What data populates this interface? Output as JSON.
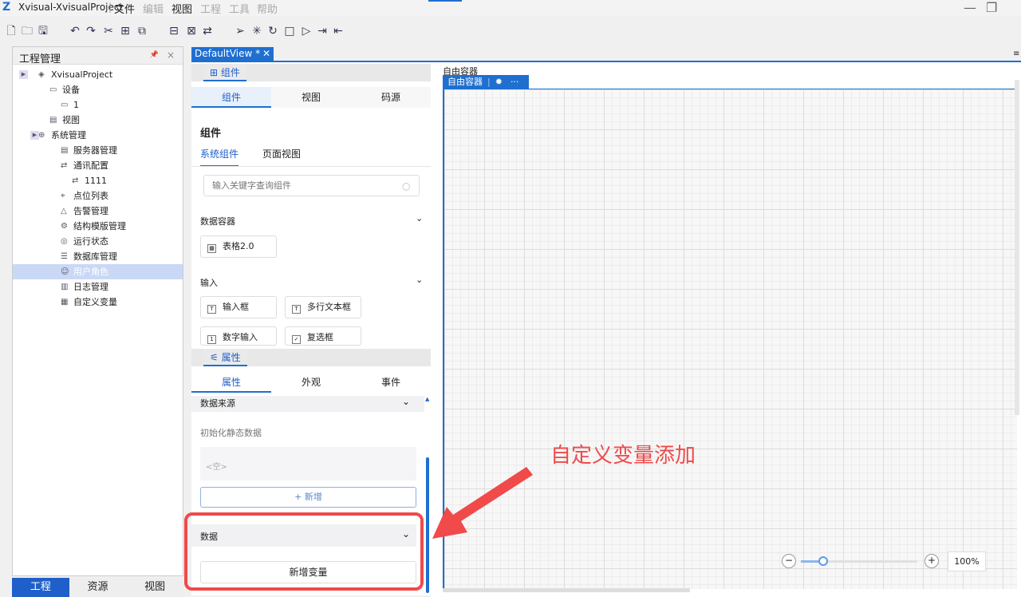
{
  "title": "Xvisual-XvisualProject",
  "menu": [
    "文件",
    "编辑",
    "视图",
    "工程",
    "工具",
    "帮助"
  ],
  "left_panel": {
    "title": "工程管理",
    "tree": [
      {
        "label": "XvisualProject",
        "icon": "layers-icon"
      },
      {
        "label": "设备",
        "icon": "device-icon"
      },
      {
        "label": "1",
        "icon": "device-icon"
      },
      {
        "label": "视图",
        "icon": "view-icon"
      },
      {
        "label": "系统管理",
        "icon": "globe-icon"
      },
      {
        "label": "服务器管理",
        "icon": "server-icon"
      },
      {
        "label": "通讯配置",
        "icon": "link-icon"
      },
      {
        "label": "1111",
        "icon": "link-icon"
      },
      {
        "label": "点位列表",
        "icon": "pin-icon"
      },
      {
        "label": "告警管理",
        "icon": "alert-icon"
      },
      {
        "label": "结构模版管理",
        "icon": "template-icon"
      },
      {
        "label": "运行状态",
        "icon": "status-icon"
      },
      {
        "label": "数据库管理",
        "icon": "database-icon"
      },
      {
        "label": "用户角色",
        "icon": "user-icon"
      },
      {
        "label": "日志管理",
        "icon": "log-icon"
      },
      {
        "label": "自定义变量",
        "icon": "variable-icon"
      }
    ],
    "bottom_tabs": [
      "工程",
      "资源",
      "视图"
    ]
  },
  "doc_tab": "DefaultView *",
  "components": {
    "section": "组件",
    "tabs": [
      "组件",
      "视图",
      "码源"
    ],
    "heading": "组件",
    "subtabs": [
      "系统组件",
      "页面视图"
    ],
    "search_placeholder": "输入关键字查询组件",
    "groups": [
      {
        "name": "数据容器",
        "items": [
          "表格2.0"
        ]
      },
      {
        "name": "输入",
        "items": [
          "输入框",
          "多行文本框",
          "数字输入",
          "复选框"
        ]
      }
    ]
  },
  "properties": {
    "section": "属性",
    "tabs": [
      "属性",
      "外观",
      "事件"
    ],
    "data_source": "数据来源",
    "init_static": "初始化静态数据",
    "empty": "<空>",
    "add": "+ 新增",
    "data": "数据",
    "add_variable": "新增变量"
  },
  "canvas": {
    "label": "自由容器",
    "container": "自由容器",
    "more": "···",
    "zoom": "100%"
  },
  "annotation": "自定义变量添加"
}
